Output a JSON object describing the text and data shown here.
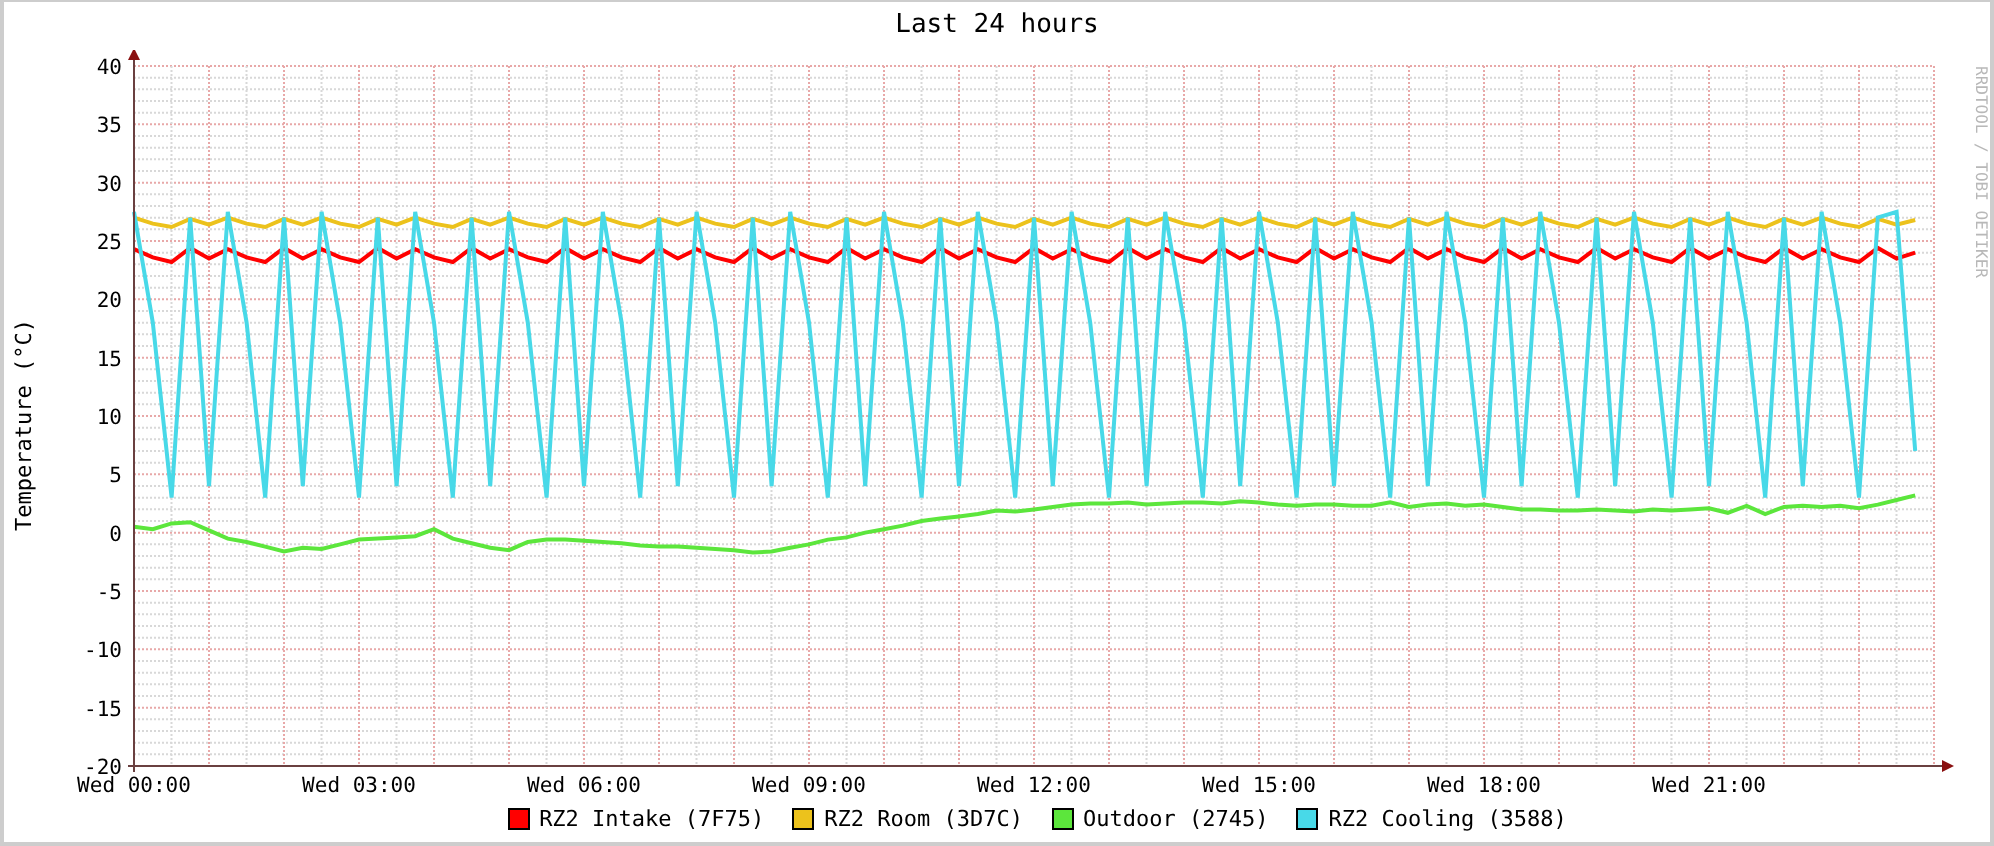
{
  "graph": {
    "credit": "RRDTOOL / TOBI OETIKER",
    "chart_data": {
      "type": "line",
      "title": "Last 24 hours",
      "ylabel": "Temperature (°C)",
      "categories": [
        "Wed 00:00",
        null,
        null,
        null,
        null,
        null,
        null,
        null,
        null,
        null,
        null,
        null,
        "Wed 03:00",
        null,
        null,
        null,
        null,
        null,
        null,
        null,
        null,
        null,
        null,
        null,
        "Wed 06:00",
        null,
        null,
        null,
        null,
        null,
        null,
        null,
        null,
        null,
        null,
        null,
        "Wed 09:00",
        null,
        null,
        null,
        null,
        null,
        null,
        null,
        null,
        null,
        null,
        null,
        "Wed 12:00",
        null,
        null,
        null,
        null,
        null,
        null,
        null,
        null,
        null,
        null,
        null,
        "Wed 15:00",
        null,
        null,
        null,
        null,
        null,
        null,
        null,
        null,
        null,
        null,
        null,
        "Wed 18:00",
        null,
        null,
        null,
        null,
        null,
        null,
        null,
        null,
        null,
        null,
        null,
        "Wed 21:00",
        null,
        null,
        null,
        null,
        null,
        null,
        null,
        null,
        null,
        null,
        null
      ],
      "ylim": [
        -20,
        40
      ],
      "grid": true,
      "legend": "bottom",
      "yticks": [
        -20,
        -15,
        -10,
        -5,
        0,
        5,
        10,
        15,
        20,
        25,
        30,
        35,
        40
      ],
      "series": [
        {
          "name": "RZ2 Intake (7F75)",
          "color": "#ff0000",
          "values": [
            24.3,
            23.6,
            23.2,
            24.4,
            23.5,
            24.3,
            23.6,
            23.2,
            24.4,
            23.5,
            24.3,
            23.6,
            23.2,
            24.4,
            23.5,
            24.3,
            23.6,
            23.2,
            24.4,
            23.5,
            24.3,
            23.6,
            23.2,
            24.4,
            23.5,
            24.3,
            23.6,
            23.2,
            24.4,
            23.5,
            24.3,
            23.6,
            23.2,
            24.4,
            23.5,
            24.3,
            23.6,
            23.2,
            24.4,
            23.5,
            24.3,
            23.6,
            23.2,
            24.4,
            23.5,
            24.3,
            23.6,
            23.2,
            24.4,
            23.5,
            24.3,
            23.6,
            23.2,
            24.4,
            23.5,
            24.3,
            23.6,
            23.2,
            24.4,
            23.5,
            24.3,
            23.6,
            23.2,
            24.4,
            23.5,
            24.3,
            23.6,
            23.2,
            24.4,
            23.5,
            24.3,
            23.6,
            23.2,
            24.4,
            23.5,
            24.3,
            23.6,
            23.2,
            24.4,
            23.5,
            24.3,
            23.6,
            23.2,
            24.4,
            23.5,
            24.3,
            23.6,
            23.2,
            24.4,
            23.5,
            24.3,
            23.6,
            23.2,
            24.4,
            23.5,
            24.0
          ]
        },
        {
          "name": "RZ2 Room (3D7C)",
          "color": "#ecc21c",
          "values": [
            27.0,
            26.5,
            26.2,
            26.9,
            26.4,
            27.0,
            26.5,
            26.2,
            26.9,
            26.4,
            27.0,
            26.5,
            26.2,
            26.9,
            26.4,
            27.0,
            26.5,
            26.2,
            26.9,
            26.4,
            27.0,
            26.5,
            26.2,
            26.9,
            26.4,
            27.0,
            26.5,
            26.2,
            26.9,
            26.4,
            27.0,
            26.5,
            26.2,
            26.9,
            26.4,
            27.0,
            26.5,
            26.2,
            26.9,
            26.4,
            27.0,
            26.5,
            26.2,
            26.9,
            26.4,
            27.0,
            26.5,
            26.2,
            26.9,
            26.4,
            27.0,
            26.5,
            26.2,
            26.9,
            26.4,
            27.0,
            26.5,
            26.2,
            26.9,
            26.4,
            27.0,
            26.5,
            26.2,
            26.9,
            26.4,
            27.0,
            26.5,
            26.2,
            26.9,
            26.4,
            27.0,
            26.5,
            26.2,
            26.9,
            26.4,
            27.0,
            26.5,
            26.2,
            26.9,
            26.4,
            27.0,
            26.5,
            26.2,
            26.9,
            26.4,
            27.0,
            26.5,
            26.2,
            26.9,
            26.4,
            27.0,
            26.5,
            26.2,
            26.9,
            26.4,
            26.8
          ]
        },
        {
          "name": "Outdoor (2745)",
          "color": "#5ce63c",
          "values": [
            0.5,
            0.3,
            0.8,
            0.9,
            0.2,
            -0.5,
            -0.8,
            -1.2,
            -1.6,
            -1.3,
            -1.4,
            -1.0,
            -0.6,
            -0.5,
            -0.4,
            -0.3,
            0.3,
            -0.5,
            -0.9,
            -1.3,
            -1.5,
            -0.8,
            -0.6,
            -0.6,
            -0.7,
            -0.8,
            -0.9,
            -1.1,
            -1.2,
            -1.2,
            -1.3,
            -1.4,
            -1.5,
            -1.7,
            -1.6,
            -1.3,
            -1.0,
            -0.6,
            -0.4,
            0.0,
            0.3,
            0.6,
            1.0,
            1.2,
            1.4,
            1.6,
            1.9,
            1.8,
            2.0,
            2.2,
            2.4,
            2.5,
            2.5,
            2.6,
            2.4,
            2.5,
            2.6,
            2.6,
            2.5,
            2.7,
            2.6,
            2.4,
            2.3,
            2.4,
            2.4,
            2.3,
            2.3,
            2.6,
            2.2,
            2.4,
            2.5,
            2.3,
            2.4,
            2.2,
            2.0,
            2.0,
            1.9,
            1.9,
            2.0,
            1.9,
            1.8,
            2.0,
            1.9,
            2.0,
            2.1,
            1.7,
            2.3,
            1.6,
            2.2,
            2.3,
            2.2,
            2.3,
            2.1,
            2.4,
            2.8,
            3.2
          ]
        },
        {
          "name": "RZ2 Cooling (3588)",
          "color": "#48d9e8",
          "values": [
            27.5,
            18,
            3,
            27,
            4,
            27.5,
            18,
            3,
            27,
            4,
            27.5,
            18,
            3,
            27,
            4,
            27.5,
            18,
            3,
            27,
            4,
            27.5,
            18,
            3,
            27,
            4,
            27.5,
            18,
            3,
            27,
            4,
            27.5,
            18,
            3,
            27,
            4,
            27.5,
            18,
            3,
            27,
            4,
            27.5,
            18,
            3,
            27,
            4,
            27.5,
            18,
            3,
            27,
            4,
            27.5,
            18,
            3,
            27,
            4,
            27.5,
            18,
            3,
            27,
            4,
            27.5,
            18,
            3,
            27,
            4,
            27.5,
            18,
            3,
            27,
            4,
            27.5,
            18,
            3,
            27,
            4,
            27.5,
            18,
            3,
            27,
            4,
            27.5,
            18,
            3,
            27,
            4,
            27.5,
            18,
            3,
            27,
            4,
            27.5,
            18,
            3,
            27,
            27.5,
            7
          ]
        }
      ]
    }
  }
}
